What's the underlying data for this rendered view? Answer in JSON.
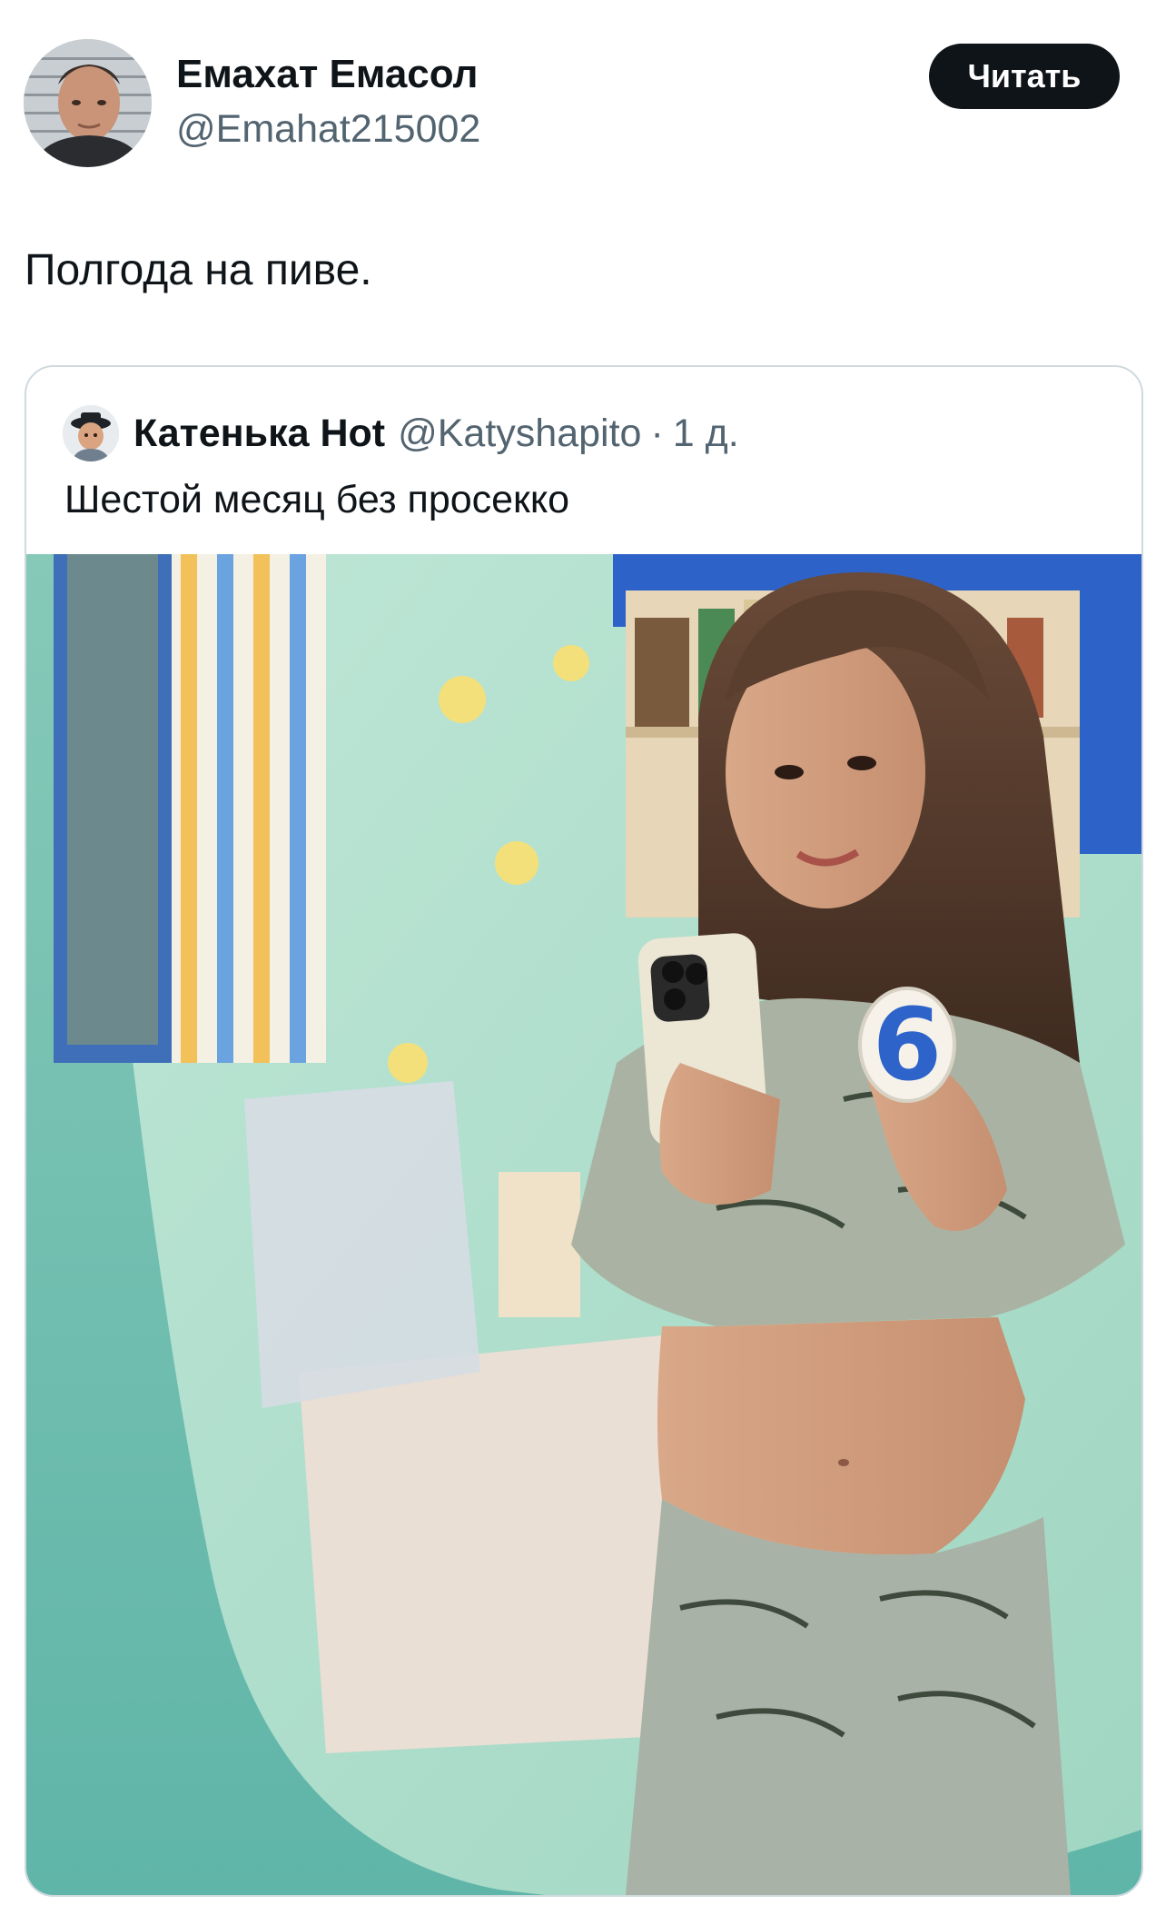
{
  "tweet": {
    "author_name": "Емахат Емасол",
    "author_handle": "@Emahat215002",
    "follow_label": "Читать",
    "text": "Полгода на пиве."
  },
  "quote": {
    "author_name": "Катенька Hot",
    "author_handle": "@Katyshapito",
    "separator": "·",
    "time": "1 д.",
    "text": "Шестой месяц без просекко",
    "candle_digit": "6"
  },
  "icons": {
    "author_avatar": "avatar-photo",
    "quote_avatar": "avatar-photo"
  },
  "colors": {
    "text_primary": "#0f1419",
    "text_secondary": "#536471",
    "button_bg": "#0f1419",
    "button_text": "#ffffff",
    "card_border": "#cfd9de"
  }
}
